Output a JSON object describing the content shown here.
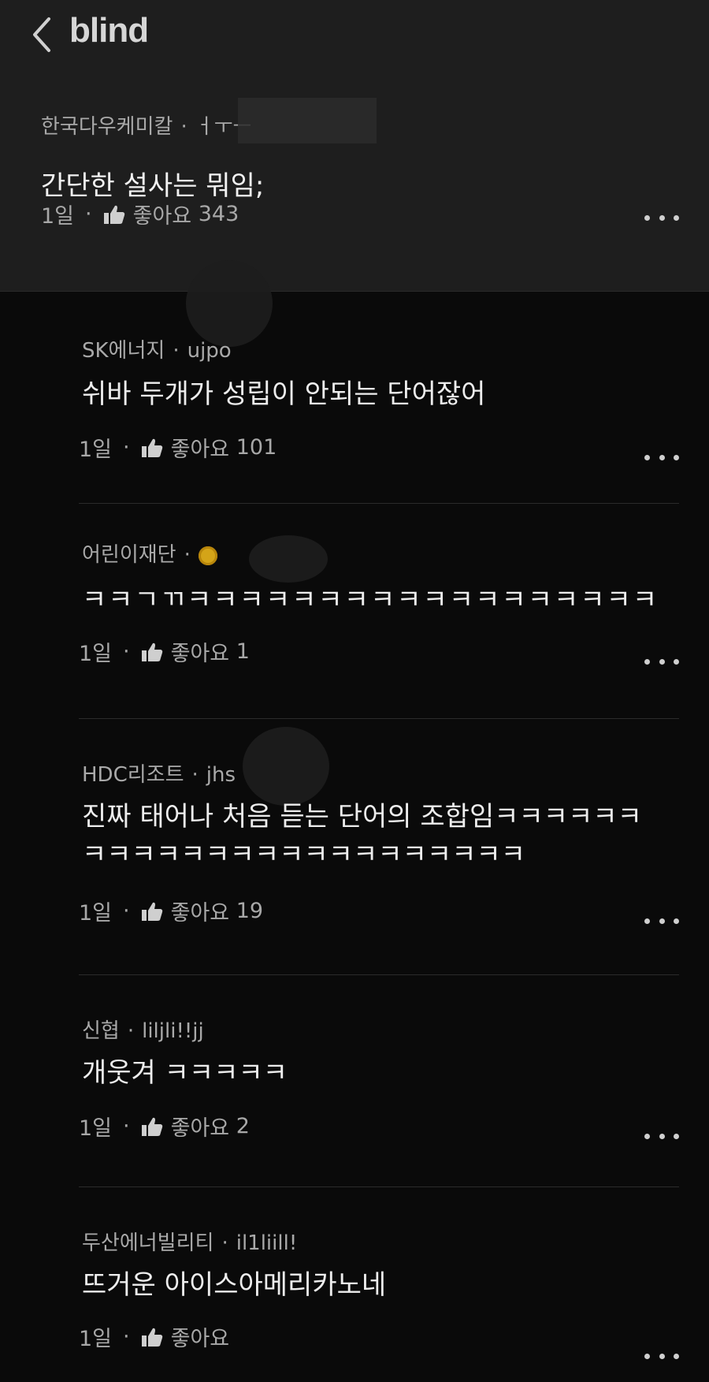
{
  "header": {
    "logo": "blind"
  },
  "post": {
    "company": "한국다우케미칼",
    "nickname": "ㅓㅜㅡ",
    "title": "간단한 설사는 뭐임;",
    "age": "1일",
    "like_label": "좋아요",
    "like_count": "343"
  },
  "comments": [
    {
      "company": "SK에너지",
      "nickname": "ujpo",
      "text": "쉬바 두개가 성립이 안되는 단어잖어",
      "age": "1일",
      "like_label": "좋아요",
      "like_count": "101"
    },
    {
      "company": "어린이재단",
      "nickname": "",
      "text": "ㅋㅋㄱㄲㅋㅋㅋㅋㅋㅋㅋㅋㅋㅋㅋㅋㅋㅋㅋㅋㅋㅋ",
      "age": "1일",
      "like_label": "좋아요",
      "like_count": "1"
    },
    {
      "company": "HDC리조트",
      "nickname": "jhs",
      "text": "진짜 태어나 처음 듣는 단어의 조합임ㅋㅋㅋㅋㅋㅋㅋㅋㅋㅋㅋㅋㅋㅋㅋㅋㅋㅋㅋㅋㅋㅋㅋㅋ",
      "age": "1일",
      "like_label": "좋아요",
      "like_count": "19"
    },
    {
      "company": "신협",
      "nickname": "liljli!!jj",
      "text": "개웃겨 ㅋㅋㅋㅋㅋ",
      "age": "1일",
      "like_label": "좋아요",
      "like_count": "2"
    },
    {
      "company": "두산에너빌리티",
      "nickname": "il1liill!",
      "text": "뜨거운 아이스아메리카노네",
      "age": "1일",
      "like_label": "좋아요",
      "like_count": ""
    }
  ],
  "colors": {
    "background": "#0a0a0a",
    "post_background": "#1e1e1e",
    "badge": "#d4a418"
  },
  "icons": [
    "back-chevron-icon",
    "thumbs-up-icon",
    "more-dots-icon",
    "badge-icon"
  ]
}
